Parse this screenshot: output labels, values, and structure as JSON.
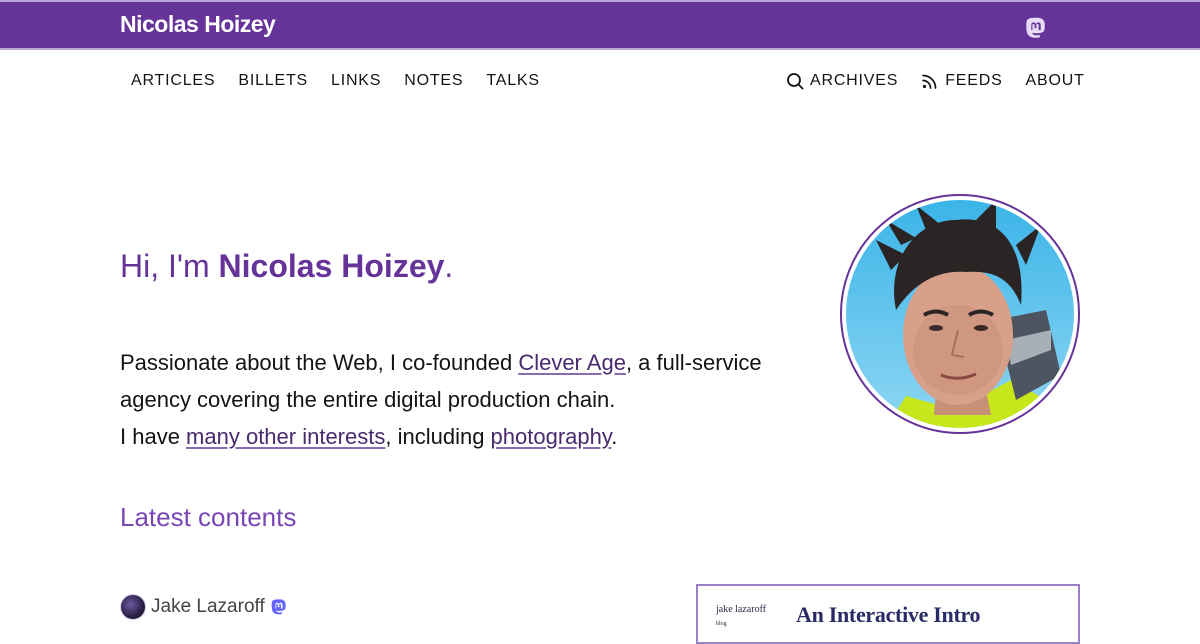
{
  "header": {
    "site_title": "Nicolas Hoizey",
    "mastodon_icon": "mastodon-icon"
  },
  "nav": {
    "left": [
      "ARTICLES",
      "BILLETS",
      "LINKS",
      "NOTES",
      "TALKS"
    ],
    "archives": "ARCHIVES",
    "feeds": "FEEDS",
    "about": "ABOUT"
  },
  "hero": {
    "greeting_prefix": "Hi, I'm ",
    "name": "Nicolas Hoizey",
    "greeting_suffix": ".",
    "intro_part1": "Passionate about the Web, I co-founded ",
    "clever_age_link": "Clever Age",
    "intro_part2": ", a full-service agency covering the entire digital production chain.",
    "intro_part3": "I have ",
    "interests_link": "many other interests",
    "intro_part4": ", including ",
    "photography_link": "photography",
    "intro_part5": "."
  },
  "latest": {
    "heading": "Latest contents",
    "author_name": "Jake Lazaroff",
    "card_brand": "jake lazaroff",
    "card_sub": "blog",
    "card_title": "An Interactive Intro"
  },
  "colors": {
    "brand_purple": "#663399",
    "heading_purple": "#7a45b5",
    "mastodon": "#6364ff"
  }
}
